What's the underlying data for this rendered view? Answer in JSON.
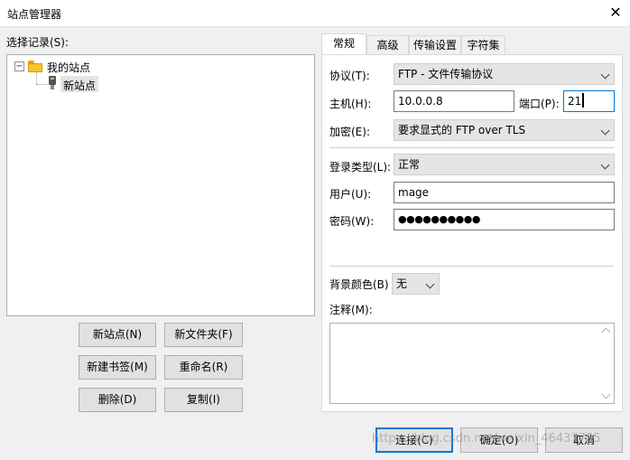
{
  "window": {
    "title": "站点管理器",
    "close_icon": "close-icon"
  },
  "left": {
    "select_label": "选择记录(S):",
    "tree": {
      "root": "我的站点",
      "child": "新站点"
    },
    "buttons": {
      "new_site": "新站点(N)",
      "new_folder": "新文件夹(F)",
      "new_bookmark": "新建书签(M)",
      "rename": "重命名(R)",
      "delete": "删除(D)",
      "copy": "复制(I)"
    }
  },
  "tabs": [
    "常规",
    "高级",
    "传输设置",
    "字符集"
  ],
  "active_tab": "常规",
  "general": {
    "protocol_label": "协议(T):",
    "protocol_value": "FTP - 文件传输协议",
    "host_label": "主机(H):",
    "host_value": "10.0.0.8",
    "port_label": "端口(P):",
    "port_value": "21",
    "encryption_label": "加密(E):",
    "encryption_value": "要求显式的 FTP over TLS",
    "logon_type_label": "登录类型(L):",
    "logon_type_value": "正常",
    "user_label": "用户(U):",
    "user_value": "mage",
    "password_label": "密码(W):",
    "password_value": "●●●●●●●●●●",
    "bg_color_label": "背景颜色(B)",
    "bg_color_value": "无",
    "comments_label": "注释(M):"
  },
  "footer": {
    "connect": "连接(C)",
    "ok": "确定(O)",
    "cancel": "取消"
  },
  "watermark": "https://blog.csdn.net/weixin_46437755",
  "colors": {
    "accent": "#0078d7",
    "window_bg": "#f0f0f0",
    "combo_bg": "#e5e5e5"
  }
}
